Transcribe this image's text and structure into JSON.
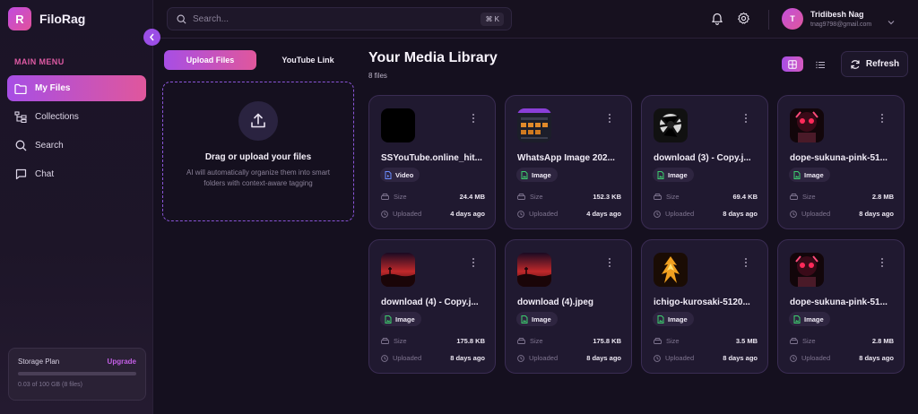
{
  "app": {
    "logo_letter": "R",
    "name": "FiloRag"
  },
  "sidebar": {
    "menu_title": "MAIN MENU",
    "items": [
      {
        "label": "My Files",
        "icon": "folder-icon",
        "active": true
      },
      {
        "label": "Collections",
        "icon": "collections-icon",
        "active": false
      },
      {
        "label": "Search",
        "icon": "search-icon",
        "active": false
      },
      {
        "label": "Chat",
        "icon": "chat-icon",
        "active": false
      }
    ],
    "storage": {
      "title": "Storage Plan",
      "upgrade": "Upgrade",
      "usage": "0.03 of 100 GB (8 files)",
      "used_fraction": 0.0003
    }
  },
  "topbar": {
    "search_placeholder": "Search...",
    "shortcut": "⌘ K",
    "user": {
      "initial": "T",
      "name": "Tridibesh Nag",
      "email": "tnag9798@gmail.com"
    }
  },
  "upload": {
    "tabs": [
      "Upload Files",
      "YouTube Link"
    ],
    "title": "Drag or upload your files",
    "subtitle": "AI will automatically organize them into smart folders with context-aware tagging"
  },
  "library": {
    "title": "Your Media Library",
    "count": "8 files",
    "refresh": "Refresh",
    "labels": {
      "size": "Size",
      "uploaded": "Uploaded"
    },
    "files": [
      {
        "name": "SSYouTube.online_hit...",
        "type": "Video",
        "size": "24.4 MB",
        "uploaded": "4 days ago",
        "thumb": "black"
      },
      {
        "name": "WhatsApp Image 202...",
        "type": "Image",
        "size": "152.3 KB",
        "uploaded": "4 days ago",
        "thumb": "ui"
      },
      {
        "name": "download (3) - Copy.j...",
        "type": "Image",
        "size": "69.4 KB",
        "uploaded": "8 days ago",
        "thumb": "bw"
      },
      {
        "name": "dope-sukuna-pink-51...",
        "type": "Image",
        "size": "2.8 MB",
        "uploaded": "8 days ago",
        "thumb": "pink"
      },
      {
        "name": "download (4) - Copy.j...",
        "type": "Image",
        "size": "175.8 KB",
        "uploaded": "8 days ago",
        "thumb": "sunset"
      },
      {
        "name": "download (4).jpeg",
        "type": "Image",
        "size": "175.8 KB",
        "uploaded": "8 days ago",
        "thumb": "sunset"
      },
      {
        "name": "ichigo-kurosaki-5120...",
        "type": "Image",
        "size": "3.5 MB",
        "uploaded": "8 days ago",
        "thumb": "fire"
      },
      {
        "name": "dope-sukuna-pink-51...",
        "type": "Image",
        "size": "2.8 MB",
        "uploaded": "8 days ago",
        "thumb": "pink"
      }
    ]
  }
}
